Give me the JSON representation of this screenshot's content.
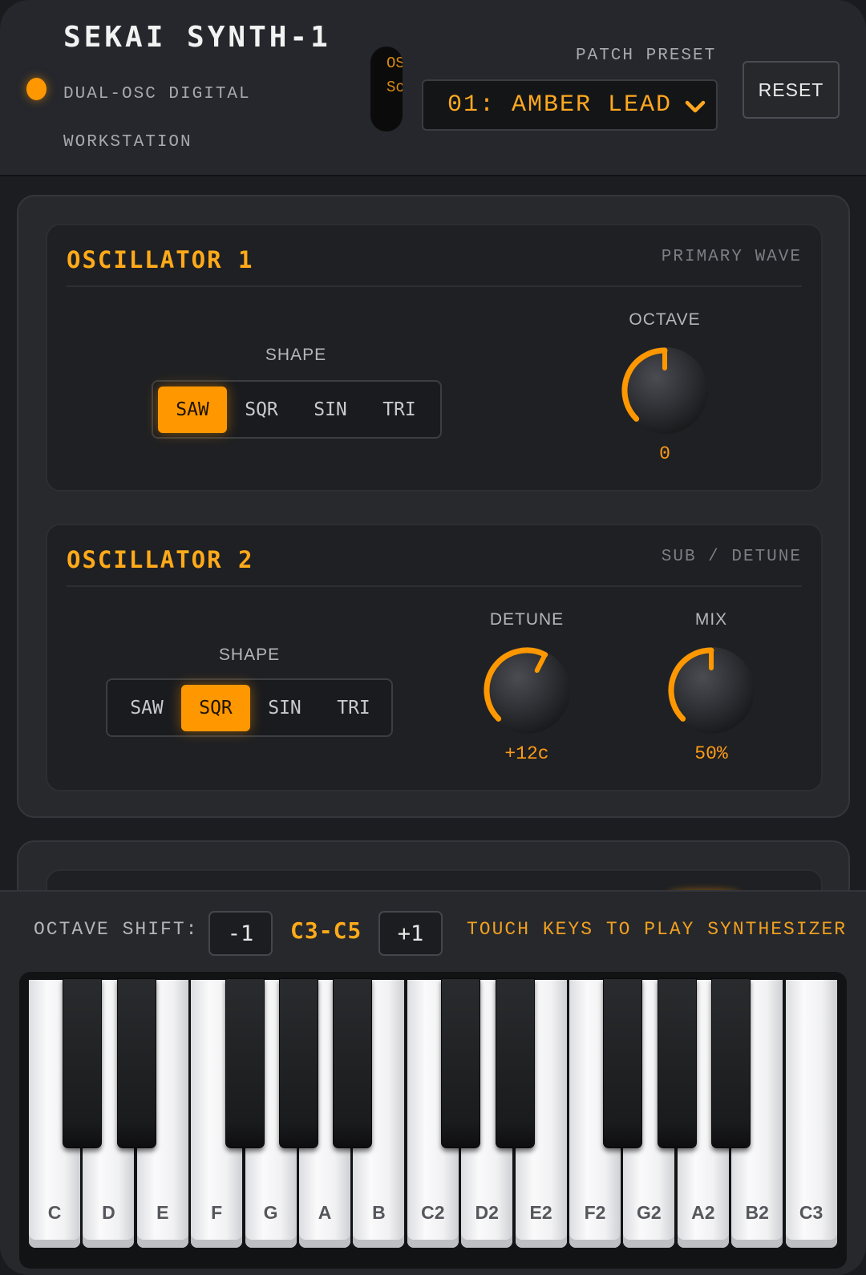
{
  "header": {
    "title": "SEKAI SYNTH-1",
    "subtitle": "DUAL-OSC DIGITAL WORKSTATION",
    "mini_screen": {
      "line1": "OS",
      "line2": "Sc"
    },
    "patch_label": "PATCH PRESET",
    "patch_value": "01: AMBER LEAD",
    "reset_label": "RESET"
  },
  "osc1": {
    "title": "OSCILLATOR 1",
    "tag": "PRIMARY WAVE",
    "shape_label": "SHAPE",
    "shapes": [
      "SAW",
      "SQR",
      "SIN",
      "TRI"
    ],
    "active_shape": "SAW",
    "octave": {
      "label": "OCTAVE",
      "value": "0",
      "level": 0.5
    }
  },
  "osc2": {
    "title": "OSCILLATOR 2",
    "tag": "SUB / DETUNE",
    "shape_label": "SHAPE",
    "shapes": [
      "SAW",
      "SQR",
      "SIN",
      "TRI"
    ],
    "active_shape": "SQR",
    "detune": {
      "label": "DETUNE",
      "value": "+12c",
      "level": 0.6
    },
    "mix": {
      "label": "MIX",
      "value": "50%",
      "level": 0.5
    }
  },
  "keyboard": {
    "octave_shift_label": "OCTAVE SHIFT:",
    "down_label": "-1",
    "up_label": "+1",
    "range": "C3-C5",
    "hint": "TOUCH KEYS TO PLAY SYNTHESIZER",
    "white_keys": [
      "C",
      "D",
      "E",
      "F",
      "G",
      "A",
      "B",
      "C2",
      "D2",
      "E2",
      "F2",
      "G2",
      "A2",
      "B2",
      "C3"
    ]
  },
  "colors": {
    "accent": "#ff9800",
    "accent_text": "#ffaa1a",
    "background": "#1c1d21"
  },
  "icons": {
    "power_led": "power-led-icon",
    "dropdown": "chevron-down-icon"
  }
}
